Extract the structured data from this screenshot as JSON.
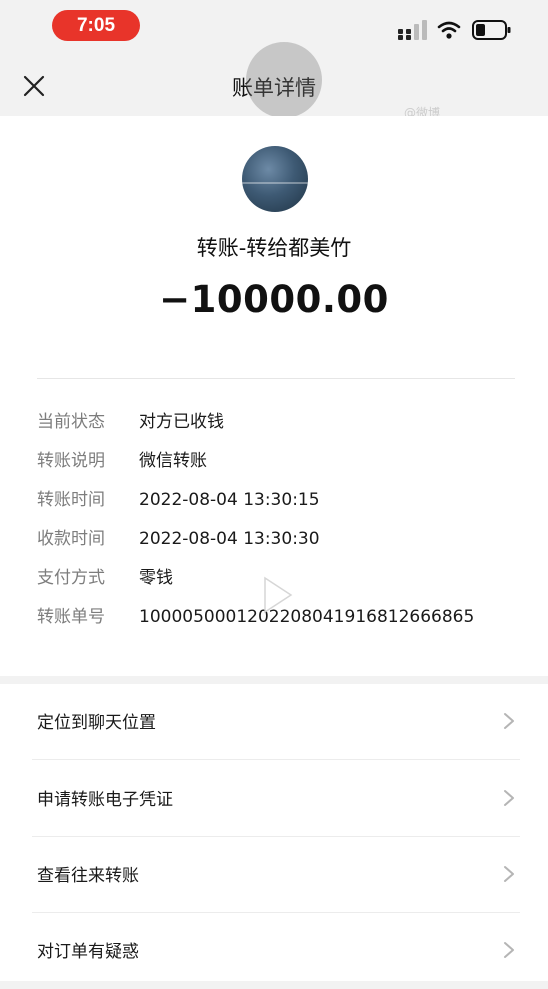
{
  "status_bar": {
    "time": "7:05",
    "signal_icon": "signal-icon",
    "wifi_icon": "wifi-icon",
    "battery_icon": "battery-icon",
    "accent": "#e8342a"
  },
  "nav": {
    "title": "账单详情",
    "close_icon": "close-icon",
    "watermark": "@微博"
  },
  "summary": {
    "payee": "转账-转给都美竹",
    "amount": "−10000.00"
  },
  "details": [
    {
      "label": "当前状态",
      "value": "对方已收钱"
    },
    {
      "label": "转账说明",
      "value": "微信转账"
    },
    {
      "label": "转账时间",
      "value": "2022-08-04 13:30:15"
    },
    {
      "label": "收款时间",
      "value": "2022-08-04 13:30:30"
    },
    {
      "label": "支付方式",
      "value": "零钱"
    },
    {
      "label": "转账单号",
      "value": "1000050001202208041916812666865"
    }
  ],
  "actions": [
    {
      "label": "定位到聊天位置"
    },
    {
      "label": "申请转账电子凭证"
    },
    {
      "label": "查看往来转账"
    },
    {
      "label": "对订单有疑惑"
    }
  ]
}
